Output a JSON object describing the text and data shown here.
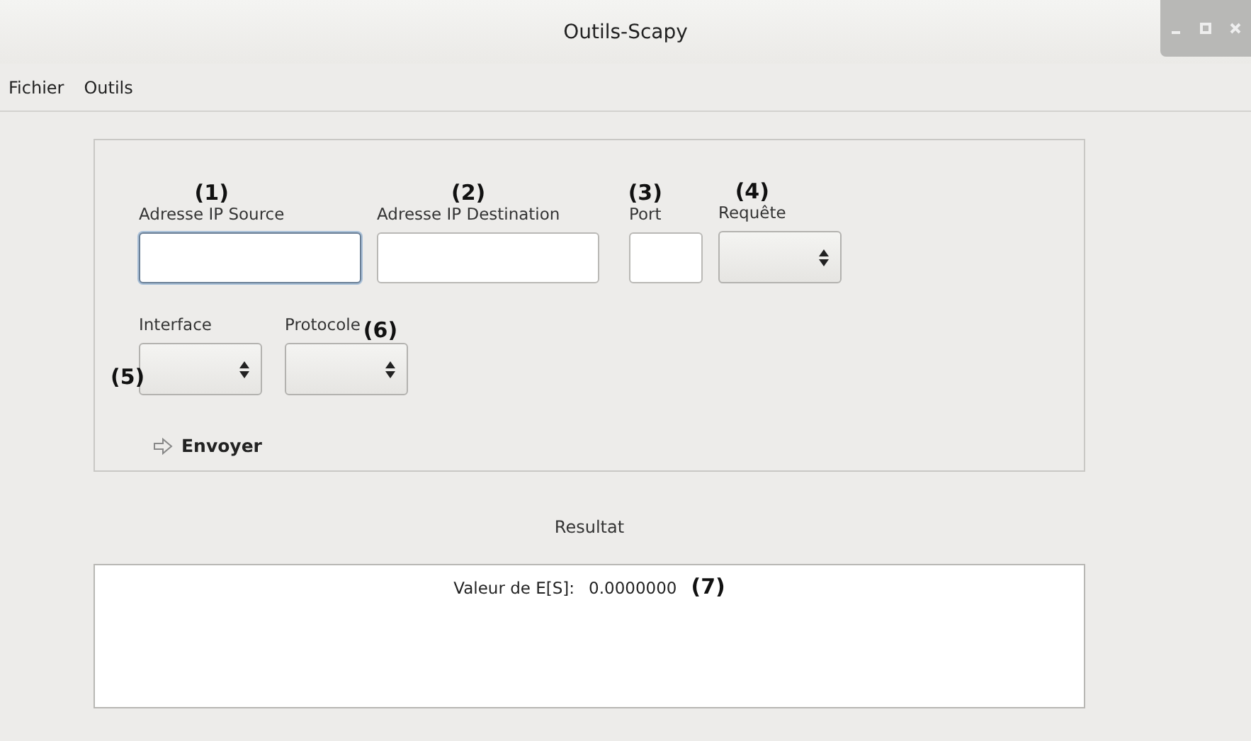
{
  "window": {
    "title": "Outils-Scapy"
  },
  "menu": [
    "Fichier",
    "Outils"
  ],
  "form": {
    "rows": [
      [
        {
          "kind": "address",
          "label": "Adresse IP Source",
          "marker": {
            "kind": "above",
            "text": "(1)"
          },
          "focused": true
        },
        {
          "kind": "address",
          "label": "Adresse IP Destination",
          "marker": {
            "kind": "above",
            "text": "(2)"
          },
          "focused": false
        },
        {
          "kind": "port",
          "label": "Port",
          "marker": {
            "kind": "above",
            "text": "(3)"
          },
          "focused": false
        },
        {
          "kind": "select",
          "label": "Requête",
          "marker": {
            "kind": "above",
            "text": "(4)"
          }
        }
      ],
      [
        {
          "kind": "select",
          "label": "Interface",
          "marker": {
            "kind": "left",
            "text": "(5)"
          }
        },
        {
          "kind": "select",
          "label": "Protocole",
          "marker": {
            "kind": "after",
            "text": "(6)"
          }
        }
      ]
    ],
    "send_button": "Envoyer"
  },
  "result": {
    "title": "Resultat",
    "label": "Valeur de E[S]:",
    "value": "0.0000000",
    "marker": "(7)"
  }
}
